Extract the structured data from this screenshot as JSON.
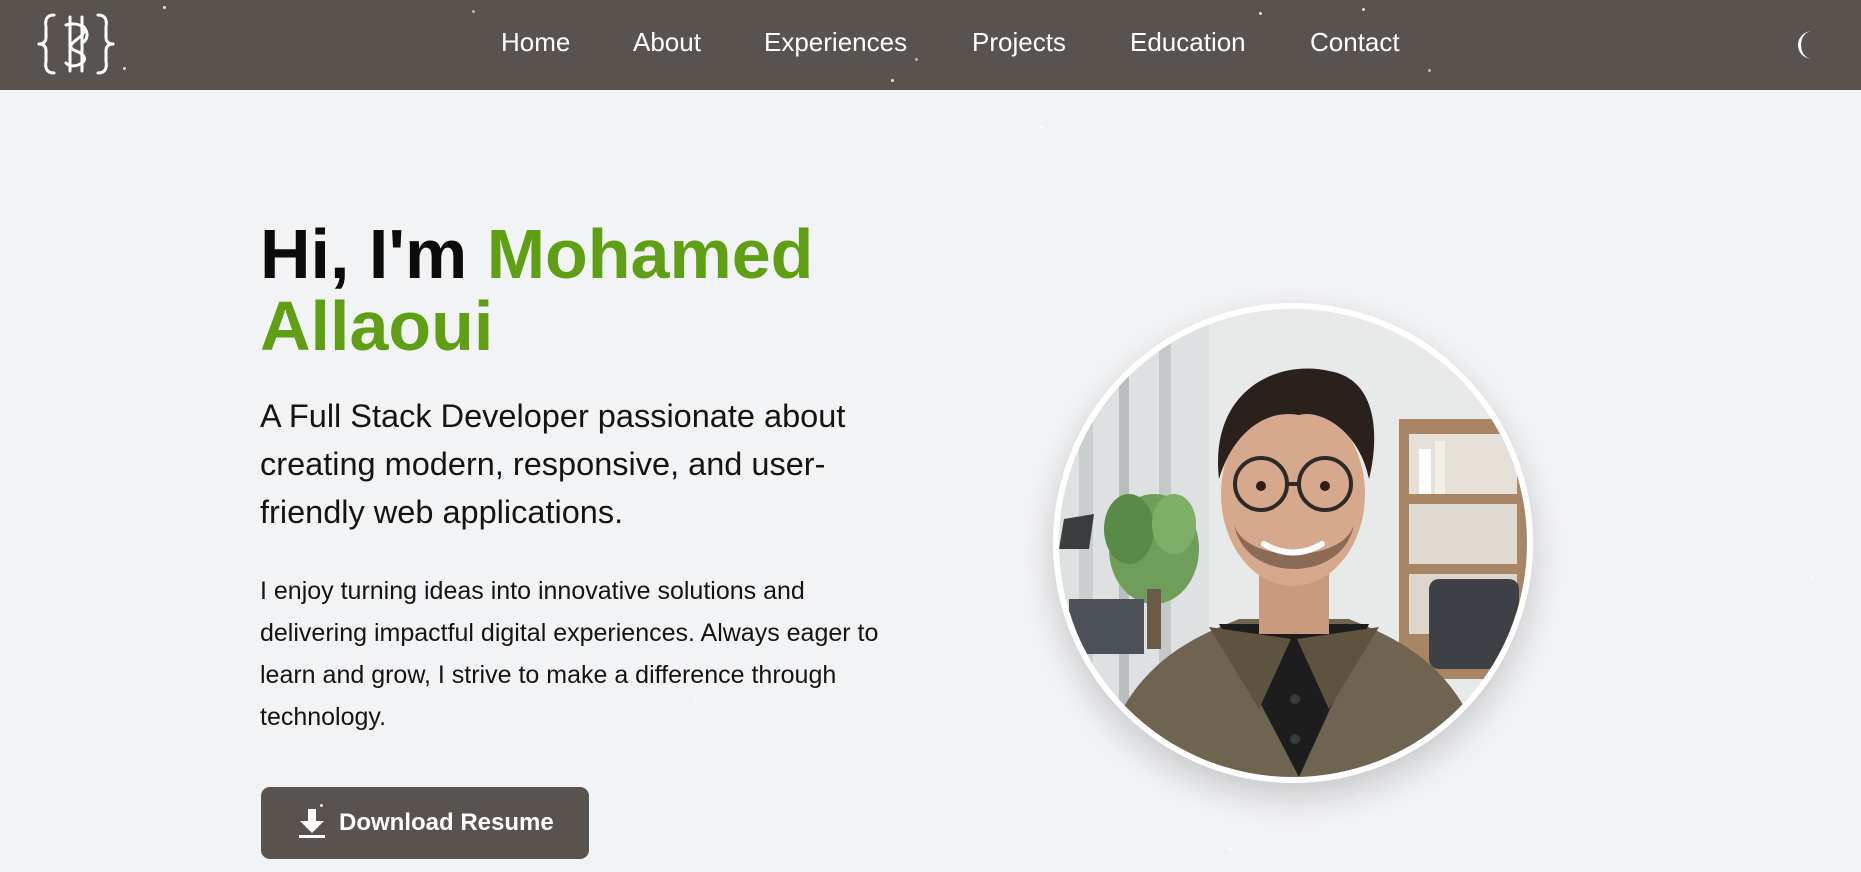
{
  "nav": {
    "links": [
      {
        "label": "Home"
      },
      {
        "label": "About"
      },
      {
        "label": "Experiences"
      },
      {
        "label": "Projects"
      },
      {
        "label": "Education"
      },
      {
        "label": "Contact"
      }
    ],
    "logo_icon": "curly-brace-monogram-logo",
    "theme_toggle_icon": "crescent-moon-icon"
  },
  "hero": {
    "greeting": "Hi, I'm ",
    "name": "Mohamed Allaoui",
    "tagline": "A Full Stack Developer passionate about creating modern, responsive, and user-friendly web applications.",
    "intro": "I enjoy turning ideas into innovative solutions and delivering impactful digital experiences. Always eager to learn and grow, I strive to make a difference through technology.",
    "cta_label": "Download Resume",
    "cta_icon": "download-icon"
  },
  "colors": {
    "nav_background": "#58534f",
    "accent_green": "#5f9f14",
    "page_background": "#f2f3f5",
    "text": "#0b0b0b"
  }
}
